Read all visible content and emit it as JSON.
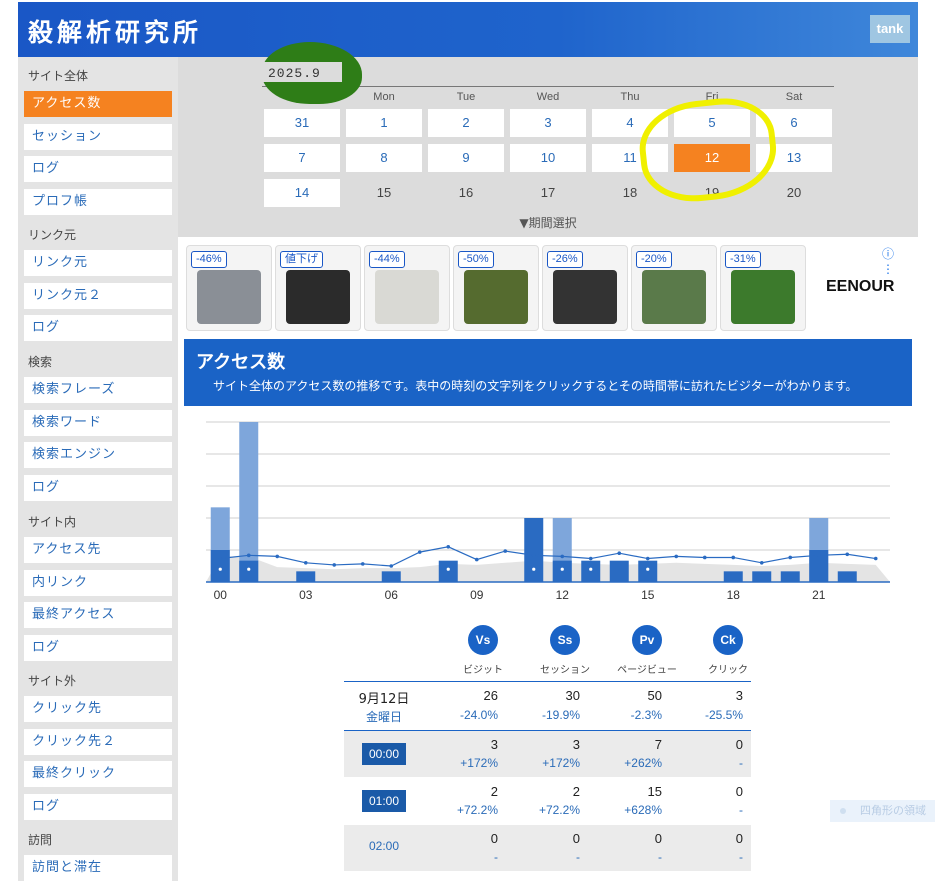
{
  "header": {
    "brand": "解析研究所",
    "brand_prefix": "殺",
    "user_button": "tank"
  },
  "sidebar": {
    "sections": [
      {
        "label": "サイト全体",
        "items": [
          "アクセス数",
          "セッション",
          "ログ",
          "プロフ帳"
        ]
      },
      {
        "label": "リンク元",
        "items": [
          "リンク元",
          "リンク元２",
          "ログ"
        ]
      },
      {
        "label": "検索",
        "items": [
          "検索フレーズ",
          "検索ワード",
          "検索エンジン",
          "ログ"
        ]
      },
      {
        "label": "サイト内",
        "items": [
          "アクセス先",
          "内リンク",
          "最終アクセス",
          "ログ"
        ]
      },
      {
        "label": "サイト外",
        "items": [
          "クリック先",
          "クリック先２",
          "最終クリック",
          "ログ"
        ]
      },
      {
        "label": "訪問",
        "items": [
          "訪問と滞在"
        ]
      }
    ],
    "active_item": "アクセス数"
  },
  "calendar": {
    "month": "2025.9",
    "weekdays": [
      "Sun",
      "Mon",
      "Tue",
      "Wed",
      "Thu",
      "Fri",
      "Sat"
    ],
    "weeks": [
      [
        "31",
        "1",
        "2",
        "3",
        "4",
        "5",
        "6"
      ],
      [
        "7",
        "8",
        "9",
        "10",
        "11",
        "12",
        "13"
      ],
      [
        "14",
        "15",
        "16",
        "17",
        "18",
        "19",
        "20"
      ]
    ],
    "selected_day": "12",
    "linked_through": "14",
    "period_toggle": "▼期間選択"
  },
  "ads": {
    "items": [
      {
        "badge": "-46%"
      },
      {
        "badge": "値下げ"
      },
      {
        "badge": "-44%"
      },
      {
        "badge": "-50%"
      },
      {
        "badge": "-26%"
      },
      {
        "badge": "-20%"
      },
      {
        "badge": "-31%"
      }
    ],
    "brand": "EENOUR",
    "info_icon": "ⓘ ⋮"
  },
  "access": {
    "title": "アクセス数",
    "description": "サイト全体のアクセス数の推移です。表中の時刻の文字列をクリックするとその時間帯に訪れたビジターがわかります。"
  },
  "chart_data": {
    "type": "bar",
    "x_tick_labels": [
      "00",
      "03",
      "06",
      "09",
      "12",
      "15",
      "18",
      "21"
    ],
    "categories": [
      "00",
      "01",
      "02",
      "03",
      "04",
      "05",
      "06",
      "07",
      "08",
      "09",
      "10",
      "11",
      "12",
      "13",
      "14",
      "15",
      "16",
      "17",
      "18",
      "19",
      "20",
      "21",
      "22",
      "23"
    ],
    "series": [
      {
        "values": [
          7,
          15,
          0,
          0,
          0,
          0,
          0,
          0,
          0,
          0,
          0,
          0,
          6,
          0,
          0,
          0,
          0,
          0,
          0,
          0,
          0,
          6,
          0,
          0
        ]
      },
      {
        "values": [
          3,
          2,
          0,
          1,
          0,
          0,
          1,
          0,
          2,
          0,
          0,
          6,
          2,
          2,
          2,
          2,
          0,
          0,
          1,
          1,
          1,
          3,
          1,
          0
        ]
      },
      {
        "values": [
          1,
          1,
          0,
          0,
          0,
          0,
          0,
          0,
          1,
          0,
          0,
          1,
          1,
          1,
          0,
          1,
          0,
          0,
          0,
          0,
          0,
          0,
          0,
          0
        ]
      },
      {
        "values": [
          2.4,
          2.4,
          1.4,
          1.3,
          1.2,
          1.3,
          1.3,
          1.4,
          1.7,
          1.6,
          1.8,
          2.0,
          1.8,
          1.7,
          1.6,
          1.7,
          1.8,
          1.7,
          1.6,
          1.5,
          1.6,
          1.8,
          1.7,
          1.6
        ]
      },
      {
        "values": [
          2.2,
          2.5,
          2.4,
          1.8,
          1.6,
          1.7,
          1.5,
          2.8,
          3.3,
          2.1,
          2.9,
          2.5,
          2.4,
          2.2,
          2.7,
          2.2,
          2.4,
          2.3,
          2.3,
          1.8,
          2.3,
          2.5,
          2.6,
          2.2
        ]
      }
    ],
    "ylim": [
      0,
      15
    ]
  },
  "stats": {
    "metrics": [
      {
        "icon": "Vs",
        "label": "ビジット"
      },
      {
        "icon": "Ss",
        "label": "セッション"
      },
      {
        "icon": "Pv",
        "label": "ページビュー"
      },
      {
        "icon": "Ck",
        "label": "クリック"
      }
    ],
    "summary": {
      "date": "9月12日",
      "weekday": "金曜日",
      "values": [
        "26",
        "30",
        "50",
        "3"
      ],
      "changes": [
        "-24.0%",
        "-19.9%",
        "-2.3%",
        "-25.5%"
      ]
    },
    "rows": [
      {
        "time": "00:00",
        "values": [
          "3",
          "3",
          "7",
          "0"
        ],
        "changes": [
          "+172%",
          "+172%",
          "+262%",
          "-"
        ]
      },
      {
        "time": "01:00",
        "values": [
          "2",
          "2",
          "15",
          "0"
        ],
        "changes": [
          "+72.2%",
          "+72.2%",
          "+628%",
          "-"
        ]
      },
      {
        "time": "02:00",
        "values": [
          "0",
          "0",
          "0",
          "0"
        ],
        "changes": [
          "-",
          "-",
          "-",
          "-"
        ]
      }
    ]
  },
  "tooltip": "四角形の領域"
}
